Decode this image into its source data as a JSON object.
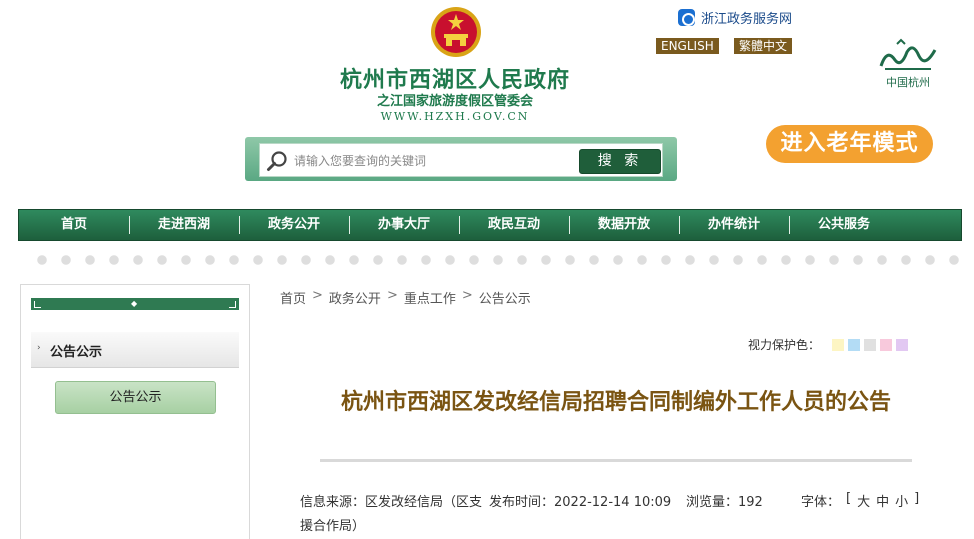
{
  "header": {
    "title": "杭州市西湖区人民政府",
    "subtitle": "之江国家旅游度假区管委会",
    "url": "WWW.HZXH.GOV.CN",
    "zj_portal": "浙江政务服务网",
    "lang_en": "ENGLISH",
    "lang_tw": "繁體中文",
    "city_logo_text": "中国杭州",
    "elder_mode": "进入老年模式"
  },
  "search": {
    "placeholder": "请输入您要查询的关键词",
    "button": "搜 索"
  },
  "nav": {
    "items": [
      "首页",
      "走进西湖",
      "政务公开",
      "办事大厅",
      "政民互动",
      "数据开放",
      "办件统计",
      "公共服务"
    ]
  },
  "sidebar": {
    "heading": "公告公示",
    "button": "公告公示"
  },
  "breadcrumb": [
    "首页",
    "政务公开",
    "重点工作",
    "公告公示"
  ],
  "breadcrumb_sep": ">",
  "vision": {
    "label": "视力保护色：",
    "colors": [
      "#fdf5c3",
      "#b3dcf5",
      "#e0e0e0",
      "#f8c9dc",
      "#e2c8f2"
    ]
  },
  "article": {
    "title": "杭州市西湖区发改经信局招聘合同制编外工作人员的公告",
    "source_label": "信息来源：",
    "source": "区发改经信局（区支援合作局）",
    "time_label": "发布时间：",
    "time": "2022-12-14 10:09",
    "views_label": "浏览量：",
    "views": "192",
    "font_label": "字体：",
    "font_open": "[",
    "font_sizes": [
      "大",
      "中",
      "小"
    ],
    "font_close": "]"
  },
  "colors": {
    "brand_green": "#1f7a4d",
    "nav_green": "#1d5f3c",
    "title_brown": "#7a5412",
    "elder_orange": "#f3a130"
  }
}
